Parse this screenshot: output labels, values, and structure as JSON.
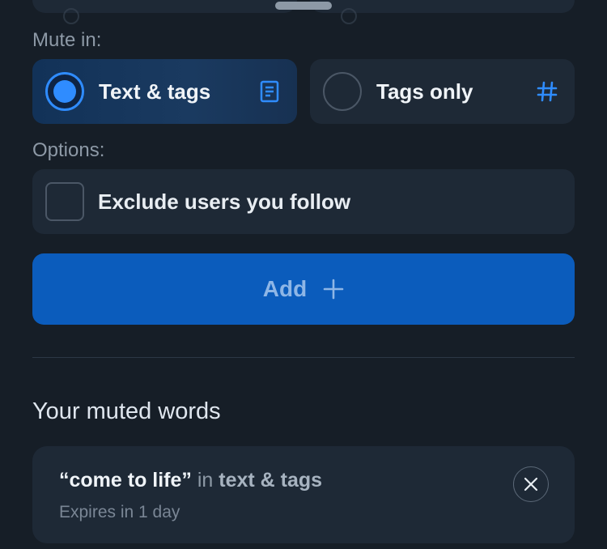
{
  "mute_in": {
    "label": "Mute in:",
    "options": [
      {
        "label": "Text & tags",
        "icon": "document-icon",
        "selected": true
      },
      {
        "label": "Tags only",
        "icon": "hash-icon",
        "selected": false
      }
    ]
  },
  "options": {
    "label": "Options:",
    "exclude_following": {
      "label": "Exclude users you follow",
      "checked": false
    }
  },
  "add_button": {
    "label": "Add",
    "icon": "plus-icon"
  },
  "muted_words": {
    "title": "Your muted words",
    "items": [
      {
        "word": "“come to life”",
        "connector": " in ",
        "scope": "text & tags",
        "expiry": "Expires in 1 day"
      }
    ]
  },
  "colors": {
    "background": "#161e27",
    "card": "#1e2936",
    "accent": "#2f8cff",
    "button": "#0b5cbc"
  }
}
